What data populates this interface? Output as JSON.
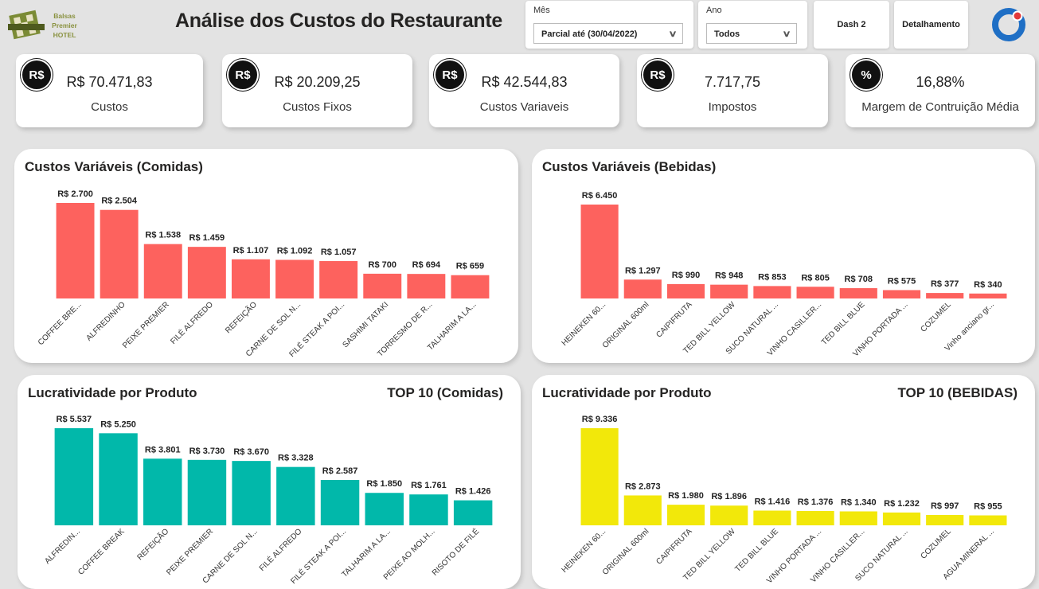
{
  "header": {
    "logo": {
      "line1": "Balsas",
      "line2": "Premier",
      "line3": "HOTEL"
    },
    "title": "Análise dos Custos do Restaurante"
  },
  "filters": {
    "mes": {
      "label": "Mês",
      "value": "Parcial até (30/04/2022)"
    },
    "ano": {
      "label": "Ano",
      "value": "Todos"
    }
  },
  "nav": {
    "dash2": "Dash 2",
    "detalhamento": "Detalhamento"
  },
  "kpis": [
    {
      "icon": "R$",
      "value": "R$ 70.471,83",
      "label": "Custos"
    },
    {
      "icon": "R$",
      "value": "R$ 20.209,25",
      "label": "Custos Fixos"
    },
    {
      "icon": "R$",
      "value": "R$ 42.544,83",
      "label": "Custos Variaveis"
    },
    {
      "icon": "R$",
      "value": "7.717,75",
      "label": "Impostos"
    },
    {
      "icon": "%",
      "value": "16,88%",
      "label": "Margem de Contruição Média"
    }
  ],
  "panels": [
    {
      "title": "Custos Variáveis (Comidas)",
      "tag": ""
    },
    {
      "title": "Custos Variáveis (Bebidas)",
      "tag": ""
    },
    {
      "title": "Lucratividade por Produto",
      "tag": "TOP 10 (Comidas)"
    },
    {
      "title": "Lucratividade por Produto",
      "tag": "TOP 10 (BEBIDAS)"
    }
  ],
  "colors": {
    "cost": "#fd625e",
    "profit_food": "#01b8aa",
    "profit_drink": "#f2e80a",
    "brand": "#1f6fc5"
  },
  "chart_data": [
    {
      "type": "bar",
      "title": "Custos Variáveis (Comidas)",
      "categories": [
        "COFFEE BRE...",
        "ALFREDINHO",
        "PEIXE PREMIER",
        "FILÉ ALFREDO",
        "REFEIÇÃO",
        "CARNE DE SOL N...",
        "FILÉ STEAK A POI...",
        "SASHIMI TATAKI",
        "TORRESMO DE R...",
        "TALHARIM A LA..."
      ],
      "values": [
        2700,
        2504,
        1538,
        1459,
        1107,
        1092,
        1057,
        700,
        694,
        659
      ],
      "labels": [
        "R$ 2.700",
        "R$ 2.504",
        "R$ 1.538",
        "R$ 1.459",
        "R$ 1.107",
        "R$ 1.092",
        "R$ 1.057",
        "R$ 700",
        "R$ 694",
        "R$ 659"
      ]
    },
    {
      "type": "bar",
      "title": "Custos Variáveis (Bebidas)",
      "categories": [
        "HEINEKEN 60...",
        "ORIGINAL 600ml",
        "CAIPIFRUTA",
        "TED BILL YELLOW",
        "SUCO NATURAL ...",
        "VINHO CASILLER...",
        "TED BILL BLUE",
        "VINHO PORTADA ...",
        "COZUMEL",
        "Vinho anciano gr..."
      ],
      "values": [
        6450,
        1297,
        990,
        948,
        853,
        805,
        708,
        575,
        377,
        340
      ],
      "labels": [
        "R$ 6.450",
        "R$ 1.297",
        "R$ 990",
        "R$ 948",
        "R$ 853",
        "R$ 805",
        "R$ 708",
        "R$ 575",
        "R$ 377",
        "R$ 340"
      ]
    },
    {
      "type": "bar",
      "title": "Lucratividade por Produto",
      "subtitle": "TOP 10 (Comidas)",
      "categories": [
        "ALFREDIN...",
        "COFFEE BREAK",
        "REFEIÇÃO",
        "PEIXE PREMIER",
        "CARNE DE SOL N...",
        "FILÉ ALFREDO",
        "FILÉ STEAK A POI...",
        "TALHARIM A LA...",
        "PEIXE AO MOLH...",
        "RISOTO DE FILÉ"
      ],
      "values": [
        5537,
        5250,
        3801,
        3730,
        3670,
        3328,
        2587,
        1850,
        1761,
        1426
      ],
      "labels": [
        "R$ 5.537",
        "R$ 5.250",
        "R$ 3.801",
        "R$ 3.730",
        "R$ 3.670",
        "R$ 3.328",
        "R$ 2.587",
        "R$ 1.850",
        "R$ 1.761",
        "R$ 1.426"
      ]
    },
    {
      "type": "bar",
      "title": "Lucratividade por Produto",
      "subtitle": "TOP 10 (BEBIDAS)",
      "categories": [
        "HEINEKEN 60...",
        "ORIGINAL 600ml",
        "CAIPIFRUTA",
        "TED BILL YELLOW",
        "TED BILL BLUE",
        "VINHO PORTADA ...",
        "VINHO CASILLER...",
        "SUCO NATURAL ...",
        "COZUMEL",
        "AGUA MINERAL ..."
      ],
      "values": [
        9336,
        2873,
        1980,
        1896,
        1416,
        1376,
        1340,
        1232,
        997,
        955
      ],
      "labels": [
        "R$ 9.336",
        "R$ 2.873",
        "R$ 1.980",
        "R$ 1.896",
        "R$ 1.416",
        "R$ 1.376",
        "R$ 1.340",
        "R$ 1.232",
        "R$ 997",
        "R$ 955"
      ]
    }
  ]
}
